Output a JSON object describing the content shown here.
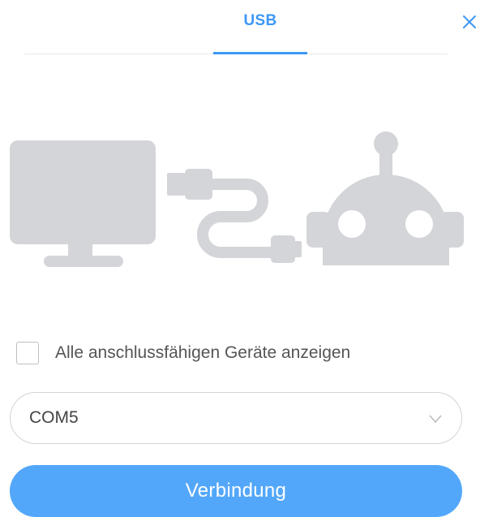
{
  "dialog": {
    "tabs": [
      {
        "label": "USB",
        "active": true
      }
    ],
    "close_icon": "close-icon"
  },
  "illustration": {
    "icons": [
      "computer-monitor-icon",
      "usb-cable-icon",
      "robot-head-icon"
    ]
  },
  "show_all_devices": {
    "label": "Alle anschlussfähigen Geräte anzeigen",
    "checked": false
  },
  "port_select": {
    "value": "COM5",
    "icon": "chevron-down-icon"
  },
  "connect_button": {
    "label": "Verbindung"
  },
  "colors": {
    "accent": "#3d97f6",
    "button": "#53a7fa",
    "illustration": "#d4d5d9"
  }
}
